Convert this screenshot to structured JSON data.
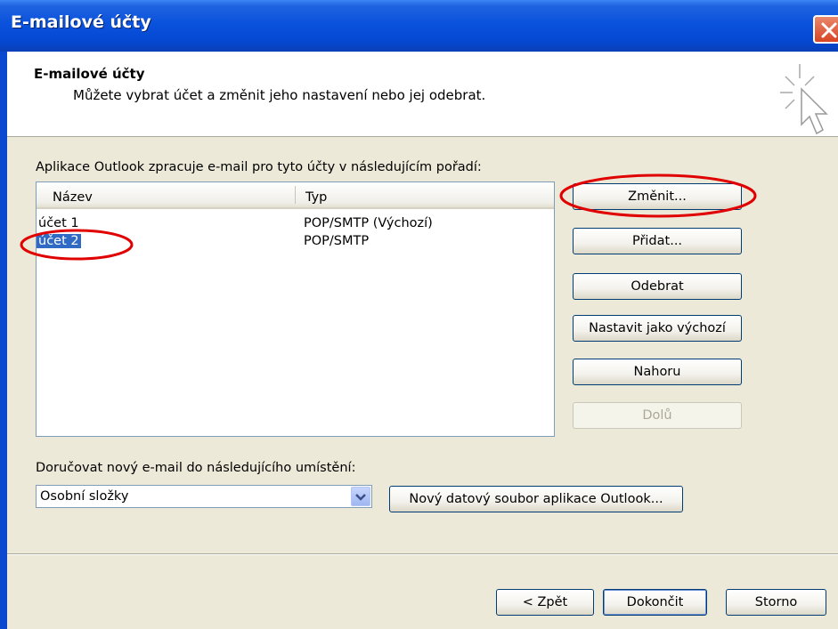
{
  "window": {
    "title": "E-mailové účty"
  },
  "header": {
    "title": "E-mailové účty",
    "subtitle": "Můžete vybrat účet a změnit jeho nastavení nebo jej odebrat."
  },
  "accounts_section": {
    "label": "Aplikace Outlook zpracuje e-mail pro tyto účty v následujícím pořadí:",
    "columns": [
      "Název",
      "Typ"
    ],
    "rows": [
      {
        "name": "účet 1",
        "type": "POP/SMTP (Výchozí)"
      },
      {
        "name": "účet 2",
        "type": "POP/SMTP"
      }
    ],
    "selected_row": 1
  },
  "side_buttons": {
    "change": "Změnit...",
    "add": "Přidat...",
    "remove": "Odebrat",
    "set_default": "Nastavit jako výchozí",
    "up": "Nahoru",
    "down": "Dolů"
  },
  "delivery": {
    "label": "Doručovat nový e-mail do následujícího umístění:",
    "selected_value": "Osobní složky",
    "new_file_button": "Nový datový soubor aplikace Outlook..."
  },
  "footer": {
    "back": "< Zpět",
    "finish": "Dokončit",
    "cancel": "Storno"
  },
  "colors": {
    "titlebar": "#0a52dc",
    "selection": "#316ac5",
    "annotation": "#e00000",
    "dialog_bg": "#ece9d8"
  }
}
